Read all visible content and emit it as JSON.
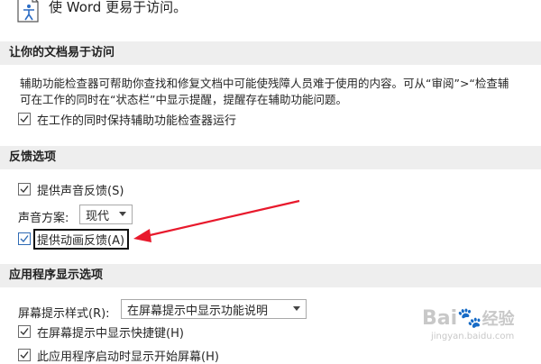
{
  "header": {
    "icon": "accessibility-document-icon",
    "text": "使 Word 更易于访问。"
  },
  "accessibility_section": {
    "title": "让你的文档易于访问",
    "description_line1": "辅助功能检查器可帮助你查找和修复文档中可能使残障人员难于使用的内容。可从“审阅”>“检查辅",
    "description_line2": "可在工作的同时在“状态栏”中显示提醒，提醒存在辅助功能问题。",
    "keep_checker_running": {
      "label": "在工作的同时保持辅助功能检查器运行",
      "checked": true
    }
  },
  "feedback_section": {
    "title": "反馈选项",
    "sound_feedback": {
      "label": "提供声音反馈(S)",
      "checked": true
    },
    "sound_scheme": {
      "label": "声音方案:",
      "value": "现代"
    },
    "animation_feedback": {
      "label": "提供动画反馈(A)",
      "checked": true
    }
  },
  "display_section": {
    "title": "应用程序显示选项",
    "screentip_style": {
      "label": "屏幕提示样式(R):",
      "value": "在屏幕提示中显示功能说明"
    },
    "show_shortcuts": {
      "label": "在屏幕提示中显示快捷键(H)",
      "checked": true
    },
    "show_start_screen": {
      "label": "此应用程序启动时显示开始屏幕(H)",
      "checked": true
    }
  },
  "annotation": {
    "arrow_color": "#e8192c",
    "box_color": "#111111"
  },
  "watermark": {
    "brand": "Bai",
    "suffix": "经验",
    "url": "jingyan.baidu.com"
  }
}
